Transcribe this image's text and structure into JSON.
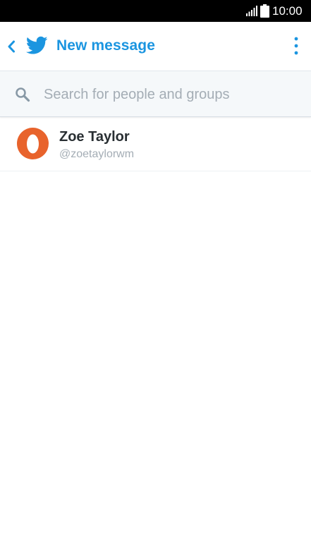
{
  "status_bar": {
    "time": "10:00",
    "signal_icon": "signal-icon",
    "battery_icon": "battery-icon"
  },
  "app_bar": {
    "back_icon": "chevron-left-icon",
    "logo_icon": "twitter-bird-icon",
    "title": "New message",
    "menu_icon": "more-vertical-icon",
    "accent_color": "#1b95e0"
  },
  "search": {
    "icon": "search-icon",
    "placeholder": "Search for people and groups",
    "value": ""
  },
  "results": [
    {
      "name": "Zoe Taylor",
      "handle": "@zoetaylorwm",
      "avatar_color": "#e8632c"
    }
  ]
}
